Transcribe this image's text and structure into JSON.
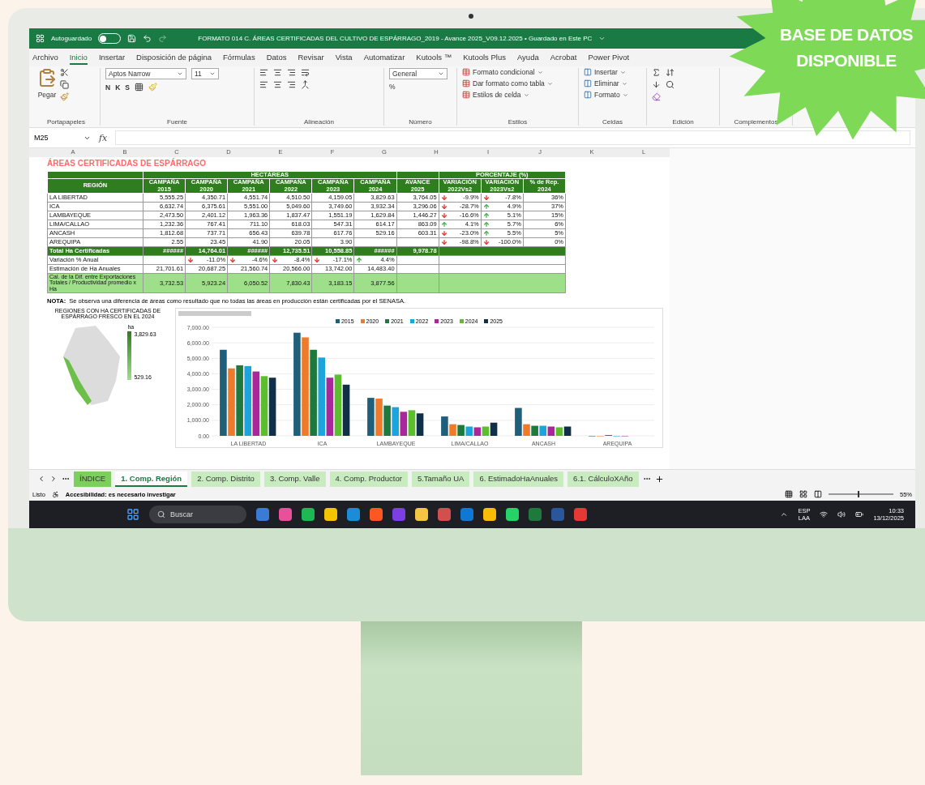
{
  "badge": {
    "text": "BASE DE DATOS DISPONIBLE"
  },
  "titlebar": {
    "autosave_label": "Autoguardado",
    "autosave_on": false,
    "title": "FORMATO 014 C. ÁREAS CERTIFICADAS DEL CULTIVO DE ESPÁRRAGO_2019 - Avance 2025_V09.12.2025 • Guardado en Este PC"
  },
  "menu": [
    {
      "label": "Archivo",
      "selected": false
    },
    {
      "label": "Inicio",
      "selected": true
    },
    {
      "label": "Insertar",
      "selected": false
    },
    {
      "label": "Disposición de página",
      "selected": false
    },
    {
      "label": "Fórmulas",
      "selected": false
    },
    {
      "label": "Datos",
      "selected": false
    },
    {
      "label": "Revisar",
      "selected": false
    },
    {
      "label": "Vista",
      "selected": false
    },
    {
      "label": "Automatizar",
      "selected": false
    },
    {
      "label": "Kutools ™",
      "selected": false
    },
    {
      "label": "Kutools Plus",
      "selected": false
    },
    {
      "label": "Ayuda",
      "selected": false
    },
    {
      "label": "Acrobat",
      "selected": false
    },
    {
      "label": "Power Pivot",
      "selected": false
    }
  ],
  "ribbon": [
    {
      "kind": "clipboard",
      "label": "Portapapeles",
      "items": [
        "Pegar"
      ]
    },
    {
      "kind": "font",
      "label": "Fuente",
      "items": [
        "Aptos Narrow",
        "11",
        "N",
        "K",
        "S"
      ]
    },
    {
      "kind": "alignment",
      "label": "Alineación"
    },
    {
      "kind": "number",
      "label": "Número",
      "items": [
        "General",
        "%"
      ]
    },
    {
      "kind": "styles",
      "label": "Estilos",
      "items": [
        "Formato condicional",
        "Dar formato como tabla",
        "Estilos de celda"
      ]
    },
    {
      "kind": "cells",
      "label": "Celdas",
      "items": [
        "Insertar",
        "Eliminar",
        "Formato"
      ]
    },
    {
      "kind": "editing",
      "label": "Edición"
    },
    {
      "kind": "addins",
      "label": "Complementos"
    }
  ],
  "formula_bar": {
    "cell": "M25",
    "fx": "fx"
  },
  "sheet": {
    "columns": [
      "A",
      "B",
      "C",
      "D",
      "E",
      "F",
      "G",
      "H",
      "I",
      "J",
      "K",
      "L"
    ],
    "title": "ÁREAS CERTIFICADAS DE ESPÁRRAGO",
    "table": {
      "group_headers": [
        "HECTÁREAS",
        "PORCENTAJE (%)"
      ],
      "columns": [
        "REGIÓN",
        "CAMPAÑA 2015",
        "CAMPAÑA 2020",
        "CAMPAÑA 2021",
        "CAMPAÑA 2022",
        "CAMPAÑA 2023",
        "CAMPAÑA 2024",
        "AVANCE 2025",
        "VARIACIÓN 2022Vs2",
        "VARIACIÓN 2023Vs2",
        "% de Rep. 2024"
      ],
      "rows": [
        {
          "region": "LA LIBERTAD",
          "values": [
            "5,555.25",
            "4,350.71",
            "4,551.74",
            "4,510.50",
            "4,159.05",
            "3,829.63",
            "3,764.05"
          ],
          "var1": {
            "rising": false,
            "text": "-9.9%"
          },
          "var2": {
            "rising": false,
            "text": "-7.8%"
          },
          "share": "36%"
        },
        {
          "region": "ICA",
          "values": [
            "6,632.74",
            "6,375.61",
            "5,551.00",
            "5,049.60",
            "3,749.60",
            "3,932.34",
            "3,296.06"
          ],
          "var1": {
            "rising": false,
            "text": "-28.7%"
          },
          "var2": {
            "rising": true,
            "text": "4.9%"
          },
          "share": "37%"
        },
        {
          "region": "LAMBAYEQUE",
          "values": [
            "2,473.50",
            "2,401.12",
            "1,963.36",
            "1,837.47",
            "1,551.19",
            "1,629.84",
            "1,446.27"
          ],
          "var1": {
            "rising": false,
            "text": "-16.6%"
          },
          "var2": {
            "rising": true,
            "text": "5.1%"
          },
          "share": "15%"
        },
        {
          "region": "LIMA/CALLAO",
          "values": [
            "1,232.36",
            "767.41",
            "711.10",
            "618.03",
            "547.31",
            "614.17",
            "863.09"
          ],
          "var1": {
            "rising": true,
            "text": "4.1%"
          },
          "var2": {
            "rising": true,
            "text": "5.7%"
          },
          "share": "6%"
        },
        {
          "region": "ANCASH",
          "values": [
            "1,812.68",
            "737.71",
            "656.43",
            "639.78",
            "617.76",
            "529.16",
            "603.31"
          ],
          "var1": {
            "rising": false,
            "text": "-23.0%"
          },
          "var2": {
            "rising": true,
            "text": "5.5%"
          },
          "share": "5%"
        },
        {
          "region": "AREQUIPA",
          "values": [
            "2.55",
            "23.45",
            "41.90",
            "20.05",
            "3.90"
          ],
          "var1": {
            "rising": false,
            "text": "-98.8%"
          },
          "var2": {
            "rising": false,
            "text": "-100.0%"
          },
          "share": "0%"
        }
      ],
      "total": {
        "label": "Total Ha Certificadas",
        "values": [
          "######",
          "14,764.01",
          "######",
          "12,735.51",
          "10,558.85",
          "######",
          "9,978.78"
        ]
      },
      "variation": {
        "label": "Variación % Anual",
        "values": [
          {
            "rising": false,
            "text": "-11.0%"
          },
          {
            "rising": false,
            "text": "-4.6%"
          },
          {
            "rising": false,
            "text": "-8.4%"
          },
          {
            "rising": false,
            "text": "-17.1%"
          },
          {
            "rising": true,
            "text": "4.4%"
          }
        ]
      },
      "estimate": {
        "label": "Estimación de Ha Anuales",
        "values": [
          "21,701.61",
          "20,687.25",
          "21,560.74",
          "20,566.00",
          "13,742.00",
          "14,483.40"
        ]
      },
      "calc": {
        "label": "Cal. de la Dif. entre Exportaciones Totales / Productividad promedio x Ha",
        "values": [
          "3,732.53",
          "5,923.24",
          "6,050.52",
          "7,830.43",
          "3,183.15",
          "3,877.56"
        ]
      }
    },
    "note_label": "NOTA:",
    "note": "Se observa una diferencia de áreas como resultado que no todas las áreas en producción están certificadas por el SENASA.",
    "map": {
      "title": "REGIONES CON HA CERTIFICADAS DE ESPÁRRAGO FRESCO EN EL 2024",
      "legend_unit": "ha",
      "legend_max": "3,829.63",
      "legend_min": "529.16"
    },
    "chart_data": {
      "type": "bar",
      "grid": true,
      "categories": [
        "LA LIBERTAD",
        "ICA",
        "LAMBAYEQUE",
        "LIMA/CALLAO",
        "ANCASH",
        "AREQUIPA"
      ],
      "series": [
        {
          "name": "2015",
          "color": "#1f5f7a",
          "values": [
            5550,
            6650,
            2450,
            1250,
            1800,
            0
          ]
        },
        {
          "name": "2020",
          "color": "#ee7a2c",
          "values": [
            4350,
            6350,
            2400,
            750,
            750,
            0
          ]
        },
        {
          "name": "2021",
          "color": "#1e7a3c",
          "values": [
            4550,
            5550,
            1950,
            700,
            650,
            50
          ]
        },
        {
          "name": "2022",
          "color": "#1ca4dc",
          "values": [
            4500,
            5050,
            1850,
            600,
            650,
            0
          ]
        },
        {
          "name": "2023",
          "color": "#a8289c",
          "values": [
            4150,
            3750,
            1550,
            550,
            600,
            0
          ]
        },
        {
          "name": "2024",
          "color": "#5cbd2e",
          "values": [
            3850,
            3950,
            1650,
            600,
            550,
            null
          ]
        },
        {
          "name": "2025",
          "color": "#10304a",
          "values": [
            3750,
            3300,
            1450,
            850,
            600,
            null
          ]
        }
      ],
      "ylim": [
        0,
        7000
      ],
      "yticks": [
        {
          "value": 0,
          "label": "0.00"
        },
        {
          "value": 1000,
          "label": "1,000.00"
        },
        {
          "value": 2000,
          "label": "2,000.00"
        },
        {
          "value": 3000,
          "label": "3,000.00"
        },
        {
          "value": 4000,
          "label": "4,000.00"
        },
        {
          "value": 5000,
          "label": "5,000.00"
        },
        {
          "value": 6000,
          "label": "6,000.00"
        },
        {
          "value": 7000,
          "label": "7,000.00"
        }
      ]
    }
  },
  "sheet_tabs": [
    {
      "label": "ÍNDICE",
      "selected": false,
      "color": "#7ccf5c"
    },
    {
      "label": "1. Comp. Región",
      "selected": true,
      "color": "#ffffff"
    },
    {
      "label": "2. Comp. Distrito",
      "selected": false,
      "color": "#c8ecc0"
    },
    {
      "label": "3. Comp. Valle",
      "selected": false,
      "color": "#c8ecc0"
    },
    {
      "label": "4. Comp. Productor",
      "selected": false,
      "color": "#c8ecc0"
    },
    {
      "label": "5.Tamaño UA",
      "selected": false,
      "color": "#c8ecc0"
    },
    {
      "label": "6. EstimadoHaAnuales",
      "selected": false,
      "color": "#c8ecc0"
    },
    {
      "label": "6.1. CálculoXAño",
      "selected": false,
      "color": "#c8ecc0"
    }
  ],
  "status_bar": {
    "state": "Listo",
    "accessibility": "Accesibilidad: es necesario investigar",
    "zoom": "55%",
    "zoom_slider": {
      "level": 0.45
    }
  },
  "taskbar": {
    "search": "Buscar",
    "lang": "ESP",
    "layout": "LAA",
    "time": "10:33",
    "date": "13/12/2025"
  }
}
